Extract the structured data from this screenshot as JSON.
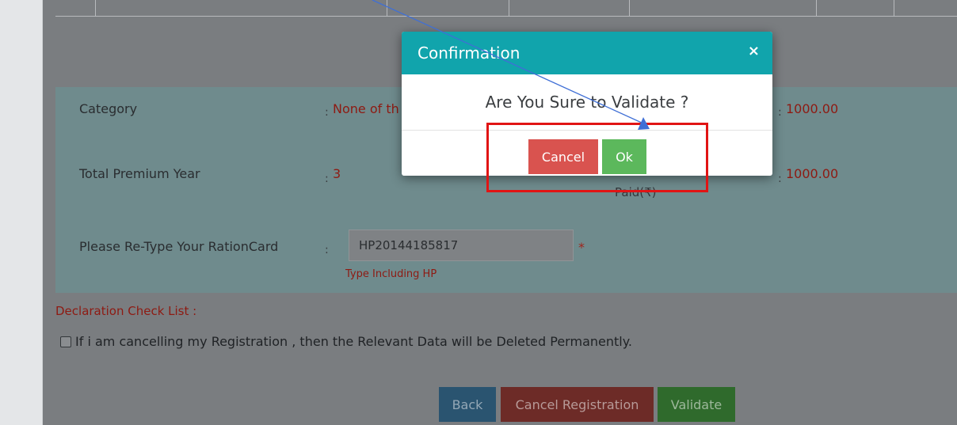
{
  "modal": {
    "title": "Confirmation",
    "close_glyph": "×",
    "question": "Are You Sure to Validate ?",
    "cancel_label": "Cancel",
    "ok_label": "Ok"
  },
  "details": {
    "colon": ":",
    "category_label": "Category",
    "category_value": "None of th",
    "category_amount": "1000.00",
    "premium_year_label": "Total Premium Year",
    "premium_year_value": "3",
    "paid_label": "Paid(₹)",
    "paid_amount": "1000.00"
  },
  "ration_card": {
    "label": "Please Re-Type Your RationCard",
    "value": "HP20144185817",
    "required_mark": "*",
    "hint": "Type Including HP"
  },
  "declaration": {
    "title": "Declaration Check List :",
    "checked": false,
    "text": "If i am cancelling my Registration , then the Relevant Data will be Deleted Permanently."
  },
  "actions": {
    "back_label": "Back",
    "cancel_registration_label": "Cancel Registration",
    "validate_label": "Validate"
  },
  "colors": {
    "modal_header": "#11a4ac",
    "cancel_button": "#d9534f",
    "ok_button": "#5cb85c",
    "highlight": "#e11414",
    "pointer_line": "#3f6fd6"
  }
}
